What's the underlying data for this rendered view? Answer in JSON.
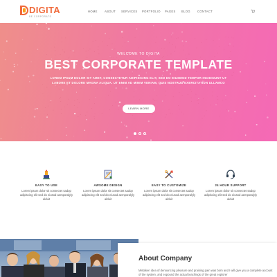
{
  "header": {
    "logo_word": "DIGITA",
    "logo_sub": "BE CORPORATE",
    "nav": [
      "HOME",
      "ABOUT",
      "SERVICES",
      "PORTFOLIO",
      "PAGES",
      "BLOG",
      "CONTACT"
    ]
  },
  "hero": {
    "eyebrow": "WELCOME TO DIGITA",
    "title": "BEST CORPORATE TEMPLATE",
    "description": "LOREM IPSUM DOLOR SIT AMET, CONSECTETUR ADIPISICING ELIT, SED DO EIUSMOD TEMPOR INCIDIDUNT UT LABORE ET DOLORE MAGNA ALIQUA. UT ENIM AD MINIM VENIAM, QUIS NOSTRUD EXERCITATION ULLAMCO",
    "button": "LEARN MORE",
    "slides": 3,
    "active_slide": 1
  },
  "features": [
    {
      "icon": "easy-use-icon",
      "title": "EASY TO USE",
      "text": "Lorem ipsum dolor sit consectet sadop adipiscing elit sed do eiusod aemporalyly alduit"
    },
    {
      "icon": "design-icon",
      "title": "AWSOME DESIGN",
      "text": "Lorem ipsum dolor sit consectet sadop adipiscing elit sed do eiusod aemporalyly alduit"
    },
    {
      "icon": "customize-icon",
      "title": "EASY TO CUSTOMIZE",
      "text": "Lorem ipsum dolor sit consectet sadop adipiscing elit sed do eiusod aemporalyly alduit"
    },
    {
      "icon": "support-icon",
      "title": "24 HOUR SUPPORT",
      "text": "Lorem ipsum dolor sit consectet sadop adipiscing elit sed do eiusod aemporalyly alduit"
    }
  ],
  "about": {
    "title": "About Company",
    "text": "Mistaken idea of denouncing pleasure and praising pain was born and I will give you a complete account of the system, and expound the actual teachings of the great explorer"
  },
  "colors": {
    "brand": "#f06a3b",
    "hero_gradient_start": "#ef8f8a",
    "hero_gradient_end": "#f569b6"
  }
}
